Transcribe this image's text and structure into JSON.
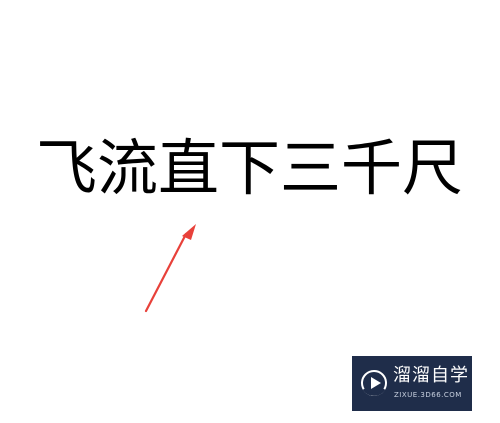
{
  "content": {
    "poem_line": "飞流直下三千尺"
  },
  "annotation": {
    "arrow_color": "#e8413a",
    "arrow_icon": "red-arrow-icon"
  },
  "watermark": {
    "name": "溜溜自学",
    "url": "ZIXUE.3D66.COM",
    "logo_icon": "play-logo-icon",
    "background_color": "#1f2d4a"
  }
}
